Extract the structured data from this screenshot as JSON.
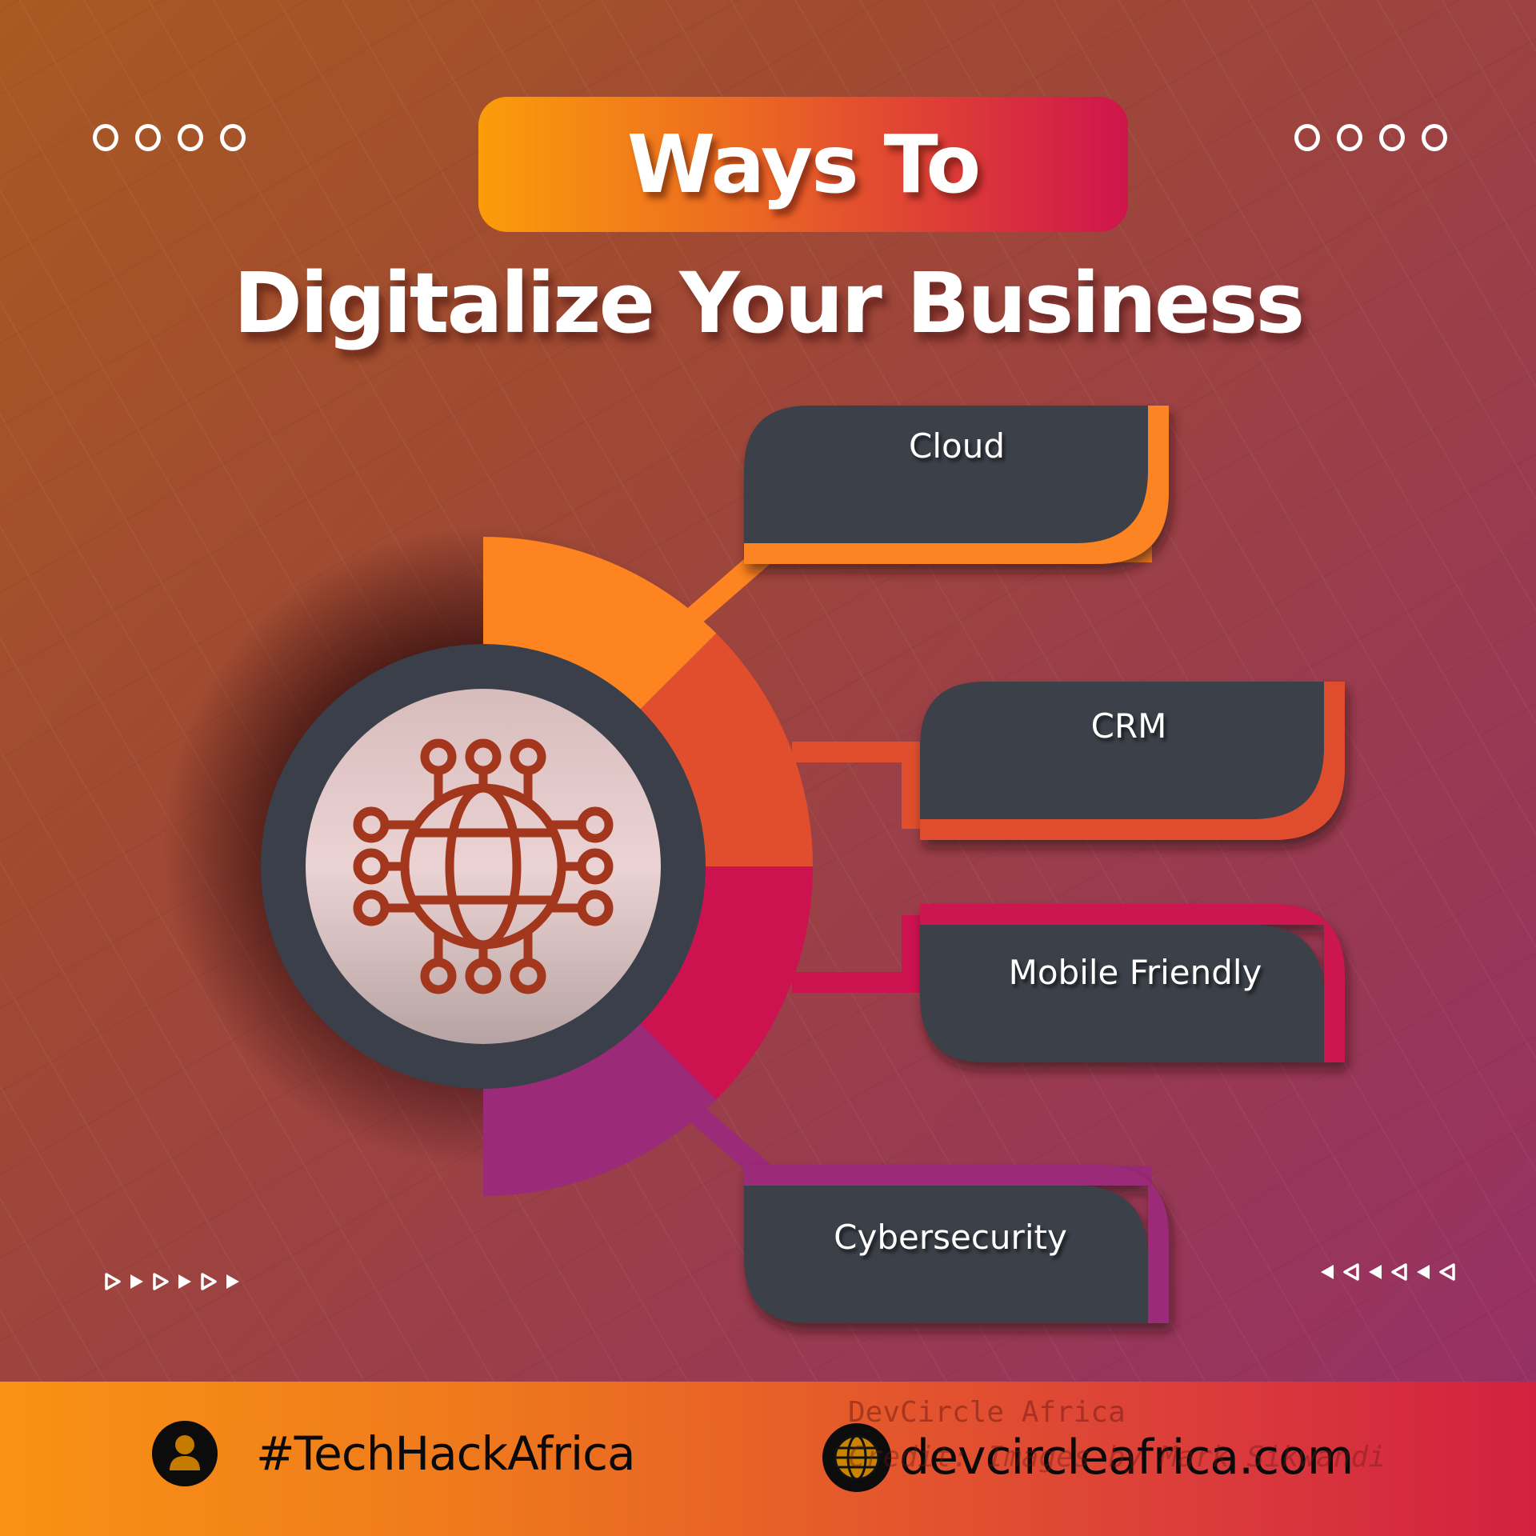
{
  "header": {
    "title_line1": "Ways To",
    "title_line2": "Digitalize Your Business"
  },
  "decor": {
    "circles_left_count": 4,
    "circles_right_count": 4,
    "arrows_left": [
      "outline",
      "solid",
      "outline",
      "solid",
      "outline",
      "solid"
    ],
    "arrows_right": [
      "solid",
      "outline",
      "solid",
      "outline",
      "solid",
      "outline"
    ]
  },
  "center_icon": "globe-network-icon",
  "items": [
    {
      "label": "Cloud",
      "color": "#fd8420"
    },
    {
      "label": "CRM",
      "color": "#e04e2d"
    },
    {
      "label": "Mobile Friendly",
      "color": "#cc124f"
    },
    {
      "label": "Cybersecurity",
      "color": "#9b2a78"
    }
  ],
  "colors": {
    "box_fill": "#3b3f49",
    "ring": "#3a3f4a",
    "icon": "#a2371e"
  },
  "footer": {
    "hashtag": "#TechHackAfrica",
    "website": "devcircleafrica.com",
    "watermark_line1": "DevCircle Africa",
    "watermark_line2": "Credit: Images by Mark Sikwandi"
  }
}
